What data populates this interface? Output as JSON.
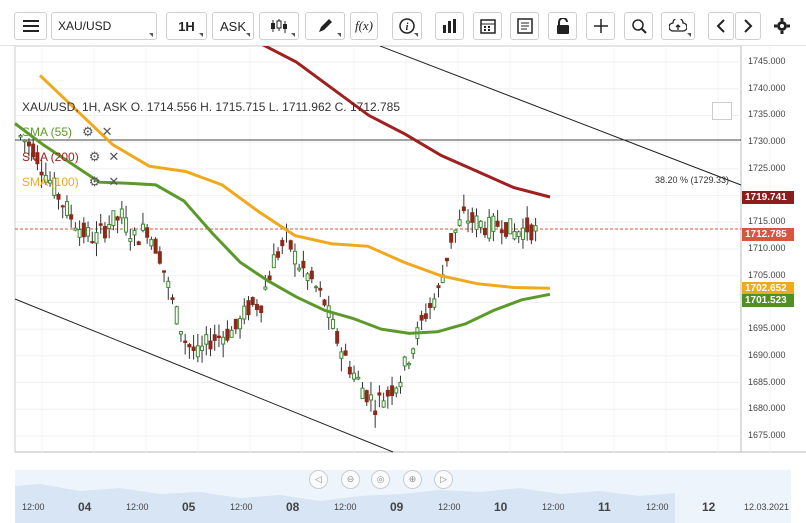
{
  "toolbar": {
    "symbol": "XAU/USD",
    "timeframe": "1H",
    "price_side": "ASK",
    "icons": [
      "menu-icon",
      "candles-icon",
      "draw-icon",
      "function-icon",
      "info-icon",
      "volume-icon",
      "calendar-icon",
      "news-icon",
      "lock-icon",
      "crosshair-icon",
      "zoom-icon",
      "upload-icon",
      "chevron-left-icon",
      "chevron-right-icon",
      "settings-icon"
    ]
  },
  "legend": {
    "ohlc": "XAU/USD, 1H, ASK    O. 1714.556 H. 1715.715 L. 1711.962 C. 1712.785",
    "sma": [
      {
        "label": "SMA (55)",
        "color": "#5b9a2a"
      },
      {
        "label": "SMA (200)",
        "color": "#a01f1f"
      },
      {
        "label": "SMA (100)",
        "color": "#f0a81c"
      }
    ]
  },
  "fib_label": "38.20 % (1729.33)",
  "price_tags": [
    {
      "label": "1719.741",
      "color": "#8b1d1d",
      "value": 1719.741
    },
    {
      "label": "1712.785",
      "color": "#d8563f",
      "value": 1712.785
    },
    {
      "label": "1702.652",
      "color": "#f0a81c",
      "value": 1702.652
    },
    {
      "label": "1701.523",
      "color": "#4f8f23",
      "value": 1701.523
    }
  ],
  "y_ticks": [
    "1745.000",
    "1740.000",
    "1735.000",
    "1730.000",
    "1725.000",
    "1720.000",
    "1715.000",
    "1710.000",
    "1705.000",
    "1700.000",
    "1695.000",
    "1690.000",
    "1685.000",
    "1680.000",
    "1675.000"
  ],
  "x_ticks": [
    {
      "label": "12:00",
      "bold": false
    },
    {
      "label": "04",
      "bold": true
    },
    {
      "label": "12:00",
      "bold": false
    },
    {
      "label": "05",
      "bold": true
    },
    {
      "label": "12:00",
      "bold": false
    },
    {
      "label": "08",
      "bold": true
    },
    {
      "label": "12:00",
      "bold": false
    },
    {
      "label": "09",
      "bold": true
    },
    {
      "label": "12:00",
      "bold": false
    },
    {
      "label": "10",
      "bold": true
    },
    {
      "label": "12:00",
      "bold": false
    },
    {
      "label": "11",
      "bold": true
    },
    {
      "label": "12:00",
      "bold": false
    },
    {
      "label": "12",
      "bold": true
    },
    {
      "label": "12.03.2021",
      "bold": false
    }
  ],
  "chart_data": {
    "type": "candlestick",
    "title": "",
    "ylim": [
      1672,
      1748
    ],
    "series": [
      {
        "name": "SMA (200)",
        "color": "#a01f1f",
        "values": [
          1748.5,
          1745.0,
          1740.0,
          1735.0,
          1731.5,
          1727.5,
          1724.5,
          1721.5,
          1719.741
        ]
      },
      {
        "name": "SMA (100)",
        "color": "#f0a81c",
        "values": [
          1742.5,
          1736.0,
          1729.5,
          1725.5,
          1724.5,
          1722.0,
          1717.0,
          1712.5,
          1711.0,
          1710.5,
          1707.5,
          1705.0,
          1703.5,
          1702.8,
          1702.652
        ]
      },
      {
        "name": "SMA (55)",
        "color": "#5b9a2a",
        "values": [
          1733.5,
          1729.5,
          1726.0,
          1722.5,
          1722.3,
          1722.0,
          1719.0,
          1713.0,
          1707.5,
          1704.0,
          1701.0,
          1698.5,
          1697.0,
          1695.0,
          1694.2,
          1694.5,
          1696.0,
          1698.5,
          1700.5,
          1701.523
        ]
      }
    ]
  }
}
